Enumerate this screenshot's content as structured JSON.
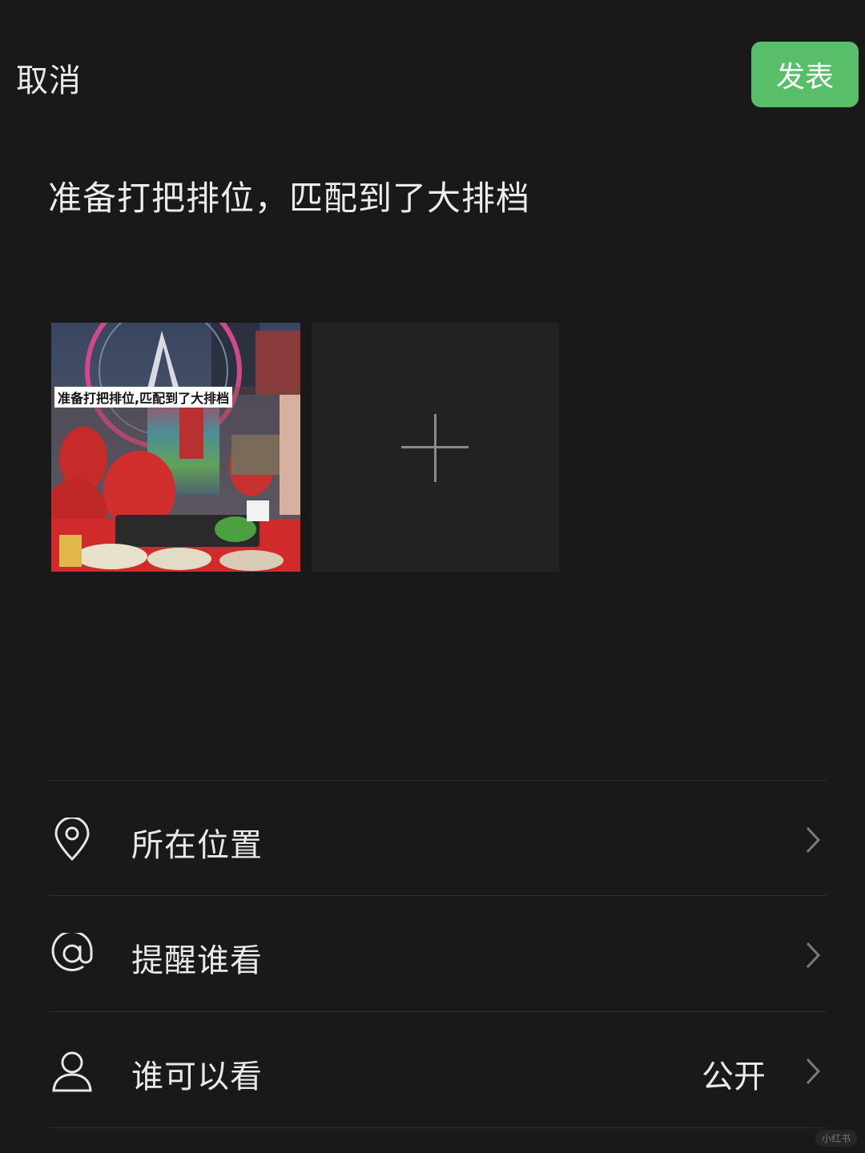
{
  "header": {
    "cancel_label": "取消",
    "publish_label": "发表"
  },
  "post": {
    "text": "准备打把排位，匹配到了大排档",
    "photo_caption": "准备打把排位,匹配到了大排档"
  },
  "options": [
    {
      "label": "所在位置",
      "value": "",
      "icon": "location-pin-icon"
    },
    {
      "label": "提醒谁看",
      "value": "",
      "icon": "at-sign-icon"
    },
    {
      "label": "谁可以看",
      "value": "公开",
      "icon": "person-icon"
    }
  ],
  "watermark": "小红书",
  "colors": {
    "background": "#191919",
    "accent": "#58be6a",
    "text": "#e9e9e9"
  }
}
